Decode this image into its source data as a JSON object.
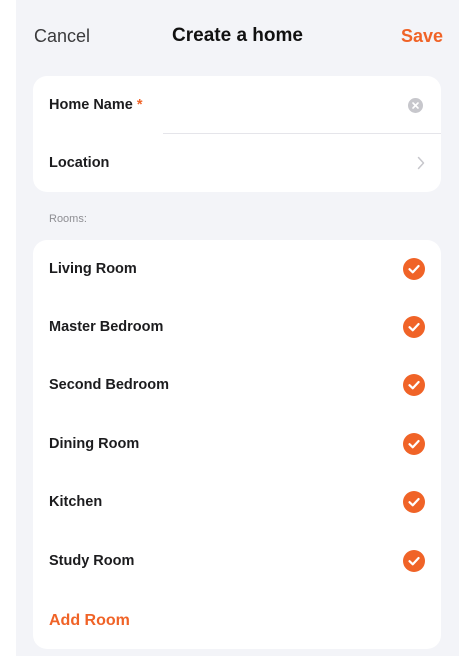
{
  "colors": {
    "accent": "#f06327",
    "background": "#f3f4f8",
    "card": "#ffffff"
  },
  "nav": {
    "cancel_label": "Cancel",
    "title": "Create a home",
    "save_label": "Save"
  },
  "home_form": {
    "name_label": "Home Name",
    "required_marker": "*",
    "name_value": "",
    "location_label": "Location"
  },
  "rooms_section_label": "Rooms:",
  "rooms": [
    {
      "label": "Living Room",
      "checked": true
    },
    {
      "label": "Master Bedroom",
      "checked": true
    },
    {
      "label": "Second Bedroom",
      "checked": true
    },
    {
      "label": "Dining Room",
      "checked": true
    },
    {
      "label": "Kitchen",
      "checked": true
    },
    {
      "label": "Study Room",
      "checked": true
    }
  ],
  "add_room_label": "Add Room",
  "icons": {
    "clear": "clear-icon",
    "chevron": "chevron-right-icon",
    "check": "check-circle-icon"
  }
}
